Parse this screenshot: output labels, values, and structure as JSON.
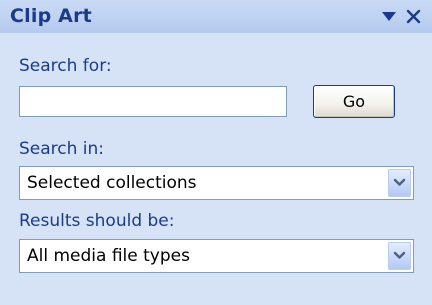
{
  "pane": {
    "title": "Clip Art",
    "menu_icon": "triangle-down-icon",
    "close_icon": "close-icon"
  },
  "search": {
    "label": "Search for:",
    "value": "",
    "button_label": "Go"
  },
  "search_in": {
    "label": "Search in:",
    "selected": "Selected collections"
  },
  "results": {
    "label": "Results should be:",
    "selected": "All media file types"
  },
  "colors": {
    "accent": "#1b3b8a",
    "pane_background": "#d6e3f7",
    "field_border": "#7f9db9"
  }
}
